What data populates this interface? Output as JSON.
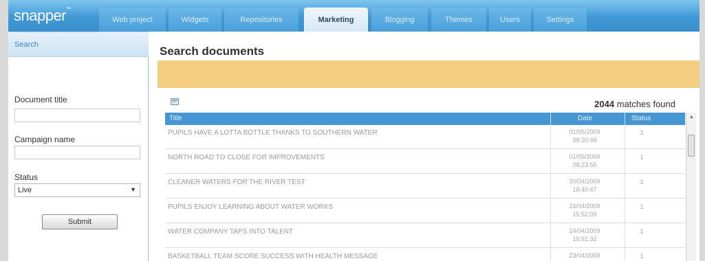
{
  "app": {
    "logo": "snapper",
    "trademark": "™"
  },
  "nav": {
    "tabs": [
      {
        "label": "Web project",
        "active": false
      },
      {
        "label": "Widgets",
        "active": false
      },
      {
        "label": "Repositories",
        "active": false
      },
      {
        "label": "Marketing",
        "active": true
      },
      {
        "label": "Blogging",
        "active": false
      },
      {
        "label": "Themes",
        "active": false
      },
      {
        "label": "Users",
        "active": false
      },
      {
        "label": "Settings",
        "active": false
      }
    ]
  },
  "sidebar": {
    "heading": "Search",
    "document_title_label": "Document title",
    "document_title_value": "",
    "campaign_name_label": "Campaign name",
    "campaign_name_value": "",
    "status_label": "Status",
    "status_value": "Live",
    "submit_label": "Submit"
  },
  "main": {
    "title": "Search documents",
    "match_count": "2044",
    "match_suffix": "matches found"
  },
  "table": {
    "columns": [
      "Title",
      "Date",
      "Status"
    ],
    "rows": [
      {
        "title": "PUPILS HAVE A LOTTA BOTTLE THANKS TO SOUTHERN WATER",
        "date": "01/05/2009",
        "time": "08:20:48",
        "status": "1"
      },
      {
        "title": "NORTH ROAD TO CLOSE FOR IMPROVEMENTS",
        "date": "01/05/2009",
        "time": "08:23:55",
        "status": "1"
      },
      {
        "title": "CLEANER WATERS FOR THE RIVER TEST",
        "date": "30/04/2009",
        "time": "10:40:47",
        "status": "1"
      },
      {
        "title": "PUPILS ENJOY LEARNING ABOUT WATER WORKS",
        "date": "24/04/2009",
        "time": "15:52:09",
        "status": "1"
      },
      {
        "title": "WATER COMPANY TAPS INTO TALENT",
        "date": "24/04/2009",
        "time": "15:51:32",
        "status": "1"
      },
      {
        "title": "BASKETBALL TEAM SCORE SUCCESS WITH HEALTH MESSAGE",
        "date": "23/04/2009",
        "time": "",
        "status": "1"
      }
    ]
  },
  "colors": {
    "accent": "#4696d3",
    "banner": "#f2cd7f",
    "sidebar_heading": "#3d8ccc"
  }
}
